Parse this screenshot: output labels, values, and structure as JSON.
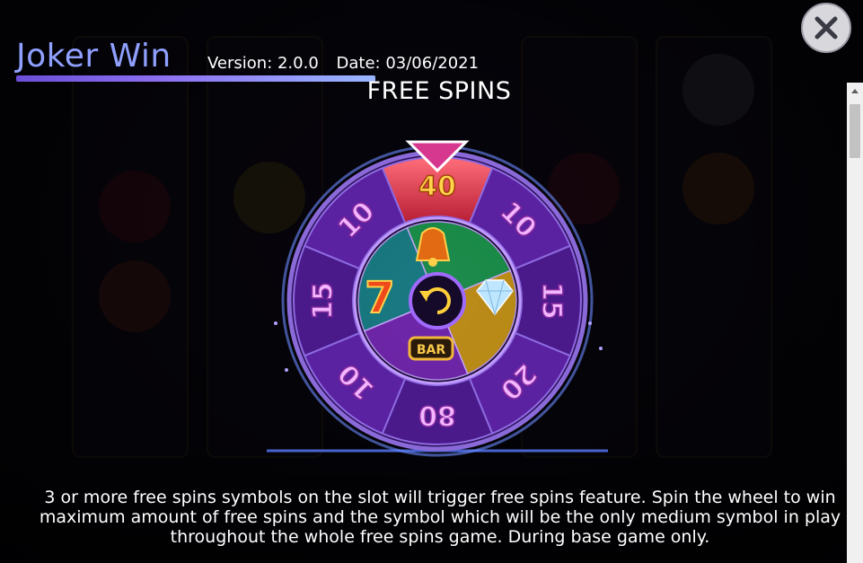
{
  "header": {
    "title": "Joker Win",
    "version": "Version: 2.0.0",
    "date": "Date: 03/06/2021"
  },
  "section": {
    "title": "FREE SPINS"
  },
  "wheel": {
    "outer_values": [
      "40",
      "10",
      "15",
      "20",
      "80",
      "10",
      "15",
      "10"
    ],
    "inner_symbols": [
      "bell-icon",
      "diamond-icon",
      "bar-icon",
      "seven-icon"
    ],
    "inner_bar_label": "BAR",
    "inner_seven_label": "7",
    "colors": {
      "highlight_segment": "#e8465a",
      "ring": "#6a2bb5",
      "number": "#f2b6ff",
      "highlight_number": "#ffd44a"
    }
  },
  "description": {
    "text": "3 or more free spins symbols on the slot will trigger free spins feature. Spin the wheel to win maximum amount of free spins and the symbol which will be the only medium symbol in play throughout the whole free spins game. During base game only."
  },
  "icons": {
    "close": "close-icon",
    "scroll_up": "scroll-up-arrow-icon",
    "center": "spin-arrow-icon"
  }
}
